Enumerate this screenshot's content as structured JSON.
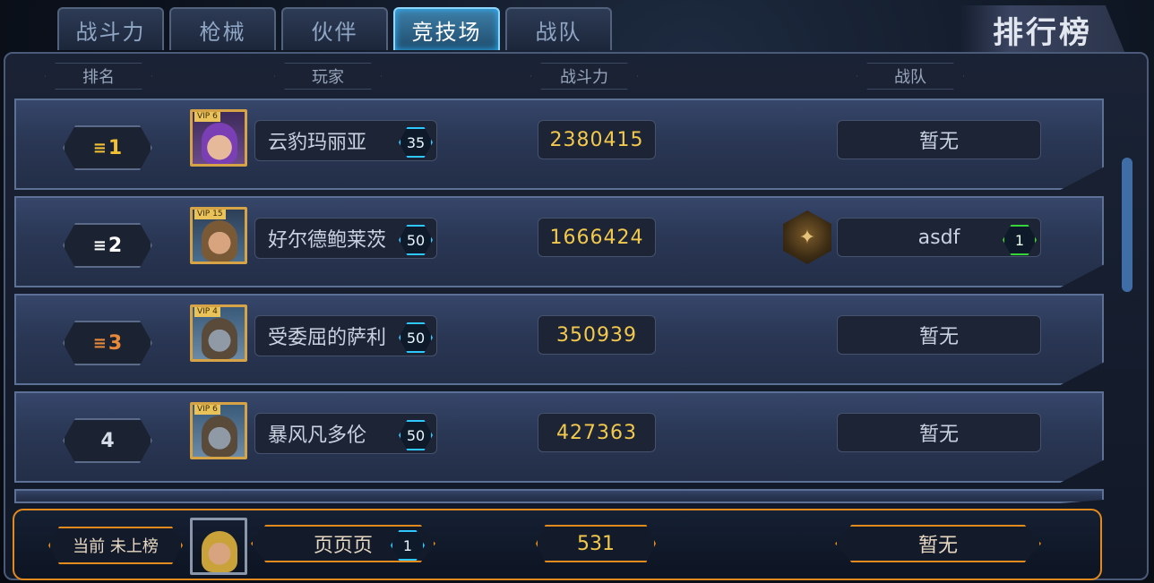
{
  "tabs": [
    {
      "label": "战斗力"
    },
    {
      "label": "枪械"
    },
    {
      "label": "伙伴"
    },
    {
      "label": "竞技场",
      "active": true
    },
    {
      "label": "战队"
    }
  ],
  "title": "排行榜",
  "columns": {
    "rank": "排名",
    "player": "玩家",
    "power": "战斗力",
    "team": "战队"
  },
  "rows": [
    {
      "rank": "1",
      "vip": "VIP 6",
      "name": "云豹玛丽亚",
      "level": "35",
      "power": "2380415",
      "team": "暂无"
    },
    {
      "rank": "2",
      "vip": "VIP 15",
      "name": "好尔德鲍莱茨",
      "level": "50",
      "power": "1666424",
      "team": "asdf",
      "team_level": "1"
    },
    {
      "rank": "3",
      "vip": "VIP 4",
      "name": "受委屈的萨利",
      "level": "50",
      "power": "350939",
      "team": "暂无"
    },
    {
      "rank": "4",
      "vip": "VIP 6",
      "name": "暴风凡多伦",
      "level": "50",
      "power": "427363",
      "team": "暂无"
    }
  ],
  "me": {
    "status": "当前 未上榜",
    "name": "页页页",
    "level": "1",
    "power": "531",
    "team": "暂无"
  }
}
